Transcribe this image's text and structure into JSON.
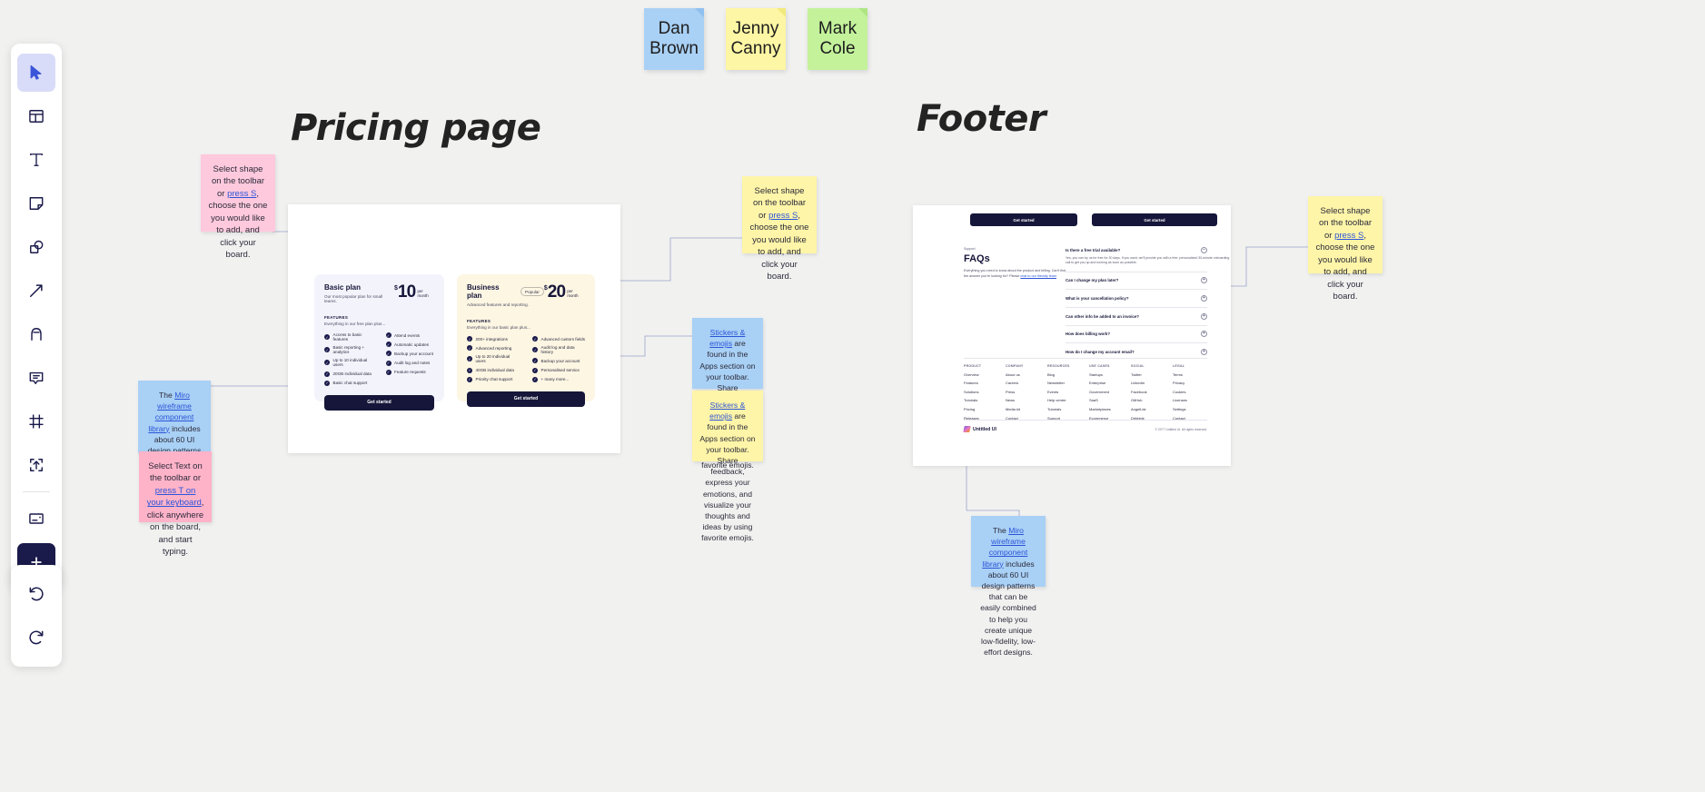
{
  "toolbar": {
    "tools": [
      {
        "name": "select-tool",
        "icon": "cursor-icon",
        "active": true
      },
      {
        "name": "templates-tool",
        "icon": "layout-icon",
        "active": false
      },
      {
        "name": "text-tool",
        "icon": "text-icon",
        "active": false
      },
      {
        "name": "sticky-note-tool",
        "icon": "sticky-note-icon",
        "active": false
      },
      {
        "name": "shapes-tool",
        "icon": "shapes-icon",
        "active": false
      },
      {
        "name": "connection-line-tool",
        "icon": "arrow-icon",
        "active": false
      },
      {
        "name": "pen-tool",
        "icon": "pen-icon",
        "active": false
      },
      {
        "name": "comment-tool",
        "icon": "comment-icon",
        "active": false
      },
      {
        "name": "frame-tool",
        "icon": "frame-icon",
        "active": false
      },
      {
        "name": "upload-tool",
        "icon": "upload-icon",
        "active": false
      }
    ],
    "extra_tools": [
      {
        "name": "card-tool",
        "icon": "card-icon"
      },
      {
        "name": "apps-more-tool",
        "icon": "plus-icon"
      }
    ],
    "bottom_tools": [
      {
        "name": "undo-button",
        "icon": "undo-icon"
      },
      {
        "name": "redo-button",
        "icon": "redo-icon"
      }
    ]
  },
  "board": {
    "titles": {
      "pricing": "Pricing page",
      "footer": "Footer"
    },
    "cursors": [
      {
        "label_line1": "Dan",
        "label_line2": "Brown",
        "color": "#a9d0f5"
      },
      {
        "label_line1": "Jenny",
        "label_line2": "Canny",
        "color": "#fdf6a4"
      },
      {
        "label_line1": "Mark",
        "label_line2": "Cole",
        "color": "#c3f29b"
      }
    ],
    "notes": {
      "shape_tip_pre": "Select shape on the toolbar or ",
      "shape_tip_link": "press S",
      "shape_tip_post": ", choose the one you would like to add, and click your board.",
      "text_tip_pre": "Select Text on the toolbar or ",
      "text_tip_link": "press T on your keyboard",
      "text_tip_post": ", click anywhere on the board, and start typing.",
      "library_tip_pre": "The ",
      "library_tip_link": "Miro wireframe component library",
      "library_tip_post": " includes about 60 UI design patterns that can be easily combined to help you create unique low-fidelity, low-effort designs.",
      "stickers_tip_link": "Stickers & emojis",
      "stickers_tip_post": " are found in the Apps section on your toolbar. Share feedback, express your emotions, and visualize your thoughts and ideas by using favorite emojis."
    }
  },
  "pricing": {
    "cards": [
      {
        "name": "Basic plan",
        "badge": "",
        "subtitle": "Our most popular plan for small teams.",
        "currency": "$",
        "amount": "10",
        "period": "per month",
        "features_label": "FEATURES",
        "features_sub": "Everything in our free plan plus...",
        "features_left": [
          "Access to basic features",
          "Basic reporting + analytics",
          "Up to 10 individual users",
          "20GB individual data",
          "Basic chat support"
        ],
        "features_right": [
          "Attend events",
          "Automatic updates",
          "Backup your account",
          "Audit log and notes",
          "Feature requests"
        ],
        "cta": "Get started"
      },
      {
        "name": "Business plan",
        "badge": "Popular",
        "subtitle": "Advanced features and reporting.",
        "currency": "$",
        "amount": "20",
        "period": "per month",
        "features_label": "FEATURES",
        "features_sub": "Everything in our basic plan plus...",
        "features_left": [
          "200+ integrations",
          "Advanced reporting",
          "Up to 20 individual users",
          "40GB individual data",
          "Priority chat support"
        ],
        "features_right": [
          "Advanced custom fields",
          "Audit log and data history",
          "Backup your account",
          "Personalised service",
          "+ many more..."
        ],
        "cta": "Get started"
      }
    ]
  },
  "footer_wireframe": {
    "top_buttons": [
      "Get started",
      "Get started"
    ],
    "faq": {
      "supertitle": "Support",
      "title": "FAQs",
      "description_pre": "Everything you need to know about the product and billing. Can't find the answer you're looking for? Please ",
      "description_link": "chat to our friendly team",
      "description_post": ".",
      "questions": [
        {
          "q": "Is there a free trial available?",
          "a": "Yes, you can try us for free for 30 days. If you want, we'll provide you with a free, personalized 30-minute onboarding call to get you up and running as soon as possible.",
          "expanded": true,
          "icon": "minus-circle-icon"
        },
        {
          "q": "Can I change my plan later?",
          "a": "",
          "expanded": false,
          "icon": "plus-circle-icon"
        },
        {
          "q": "What is your cancellation policy?",
          "a": "",
          "expanded": false,
          "icon": "plus-circle-icon"
        },
        {
          "q": "Can other info be added to an invoice?",
          "a": "",
          "expanded": false,
          "icon": "plus-circle-icon"
        },
        {
          "q": "How does billing work?",
          "a": "",
          "expanded": false,
          "icon": "plus-circle-icon"
        },
        {
          "q": "How do I change my account email?",
          "a": "",
          "expanded": false,
          "icon": "plus-circle-icon"
        }
      ]
    },
    "link_columns": [
      {
        "header": "PRODUCT",
        "items": [
          "Overview",
          "Features",
          "Solutions",
          "Tutorials",
          "Pricing",
          "Releases"
        ]
      },
      {
        "header": "COMPANY",
        "items": [
          "About us",
          "Careers",
          "Press",
          "News",
          "Media kit",
          "Contact"
        ]
      },
      {
        "header": "RESOURCES",
        "items": [
          "Blog",
          "Newsletter",
          "Events",
          "Help centre",
          "Tutorials",
          "Support"
        ]
      },
      {
        "header": "USE CASES",
        "items": [
          "Startups",
          "Enterprise",
          "Government",
          "SaaS",
          "Marketplaces",
          "Ecommerce"
        ]
      },
      {
        "header": "SOCIAL",
        "items": [
          "Twitter",
          "LinkedIn",
          "Facebook",
          "GitHub",
          "AngelList",
          "Dribbble"
        ]
      },
      {
        "header": "LEGAL",
        "items": [
          "Terms",
          "Privacy",
          "Cookies",
          "Licenses",
          "Settings",
          "Contact"
        ]
      }
    ],
    "brand": "Untitled UI",
    "copyright": "© 2077 Untitled UI. All rights reserved."
  }
}
